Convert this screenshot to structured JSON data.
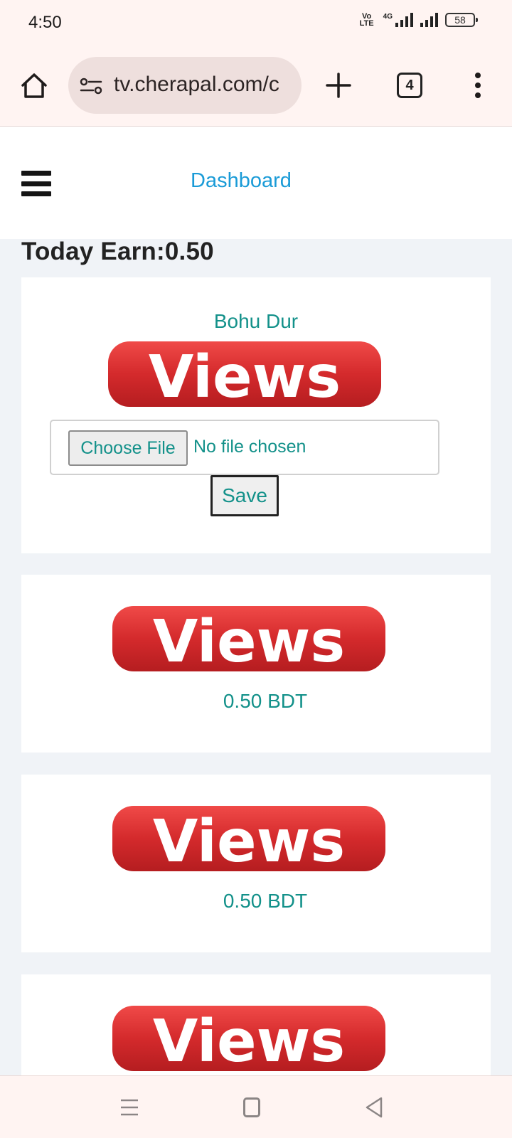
{
  "status_bar": {
    "time": "4:50",
    "volte_label": "Vo LTE",
    "network_type": "4G",
    "battery_level": "58"
  },
  "browser": {
    "url": "tv.cherapal.com/c",
    "tab_count": "4"
  },
  "site_header": {
    "nav_link": "Dashboard"
  },
  "today_earn": "Today Earn:0.50",
  "upload_card": {
    "title": "Bohu Dur",
    "logo_text": "Views",
    "choose_file_label": "Choose File",
    "no_file_label": "No file chosen",
    "save_label": "Save"
  },
  "earning_cards": [
    {
      "logo_text": "Views",
      "amount": "0.50 BDT"
    },
    {
      "logo_text": "Views",
      "amount": "0.50 BDT"
    },
    {
      "logo_text": "Views"
    }
  ],
  "colors": {
    "accent_teal": "#13918a",
    "link_blue": "#1a9bd7",
    "logo_red": "#d42a2c",
    "chrome_bg": "#fff4f2",
    "page_bg": "#f0f3f7"
  },
  "icons": [
    "home-icon",
    "site-settings-icon",
    "plus-icon",
    "more-vert-icon",
    "hamburger-icon",
    "recents-icon",
    "home-nav-icon",
    "back-icon"
  ]
}
